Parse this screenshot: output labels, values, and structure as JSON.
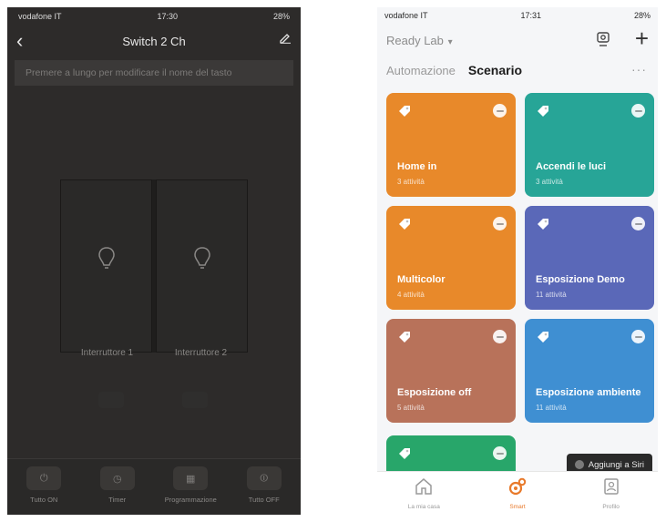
{
  "left_phone": {
    "status": {
      "carrier": "vodafone IT",
      "time": "17:30",
      "battery": "28%"
    },
    "nav": {
      "title": "Switch 2 Ch"
    },
    "hint": "Premere a lungo per modificare il nome del tasto",
    "switch_labels": [
      "Interruttore 1",
      "Interruttore 2"
    ],
    "bottom_bar": [
      {
        "label": "Tutto ON",
        "icon": "power-icon"
      },
      {
        "label": "Timer",
        "icon": "timer-icon"
      },
      {
        "label": "Programmazione",
        "icon": "schedule-icon"
      },
      {
        "label": "Tutto OFF",
        "icon": "power-off-icon"
      }
    ],
    "colors": {
      "background": "#2d2b2a",
      "panel": "#1f1e1d"
    }
  },
  "right_phone": {
    "status": {
      "carrier": "vodafone IT",
      "time": "17:31",
      "battery": "28%"
    },
    "home_name": "Ready Lab",
    "tabs": {
      "automation": "Automazione",
      "scenario": "Scenario"
    },
    "scenes": [
      {
        "name": "Home in",
        "sub": "3 attività",
        "color": "#e8892a"
      },
      {
        "name": "Accendi le luci",
        "sub": "3 attività",
        "color": "#27a597"
      },
      {
        "name": "Multicolor",
        "sub": "4 attività",
        "color": "#e8892a"
      },
      {
        "name": "Esposizione Demo",
        "sub": "11 attività",
        "color": "#5a68b8"
      },
      {
        "name": "Esposizione off",
        "sub": "5 attività",
        "color": "#b8725a"
      },
      {
        "name": "Esposizione ambiente",
        "sub": "11 attività",
        "color": "#3f8fd2"
      }
    ],
    "last_card_color": "#28a66a",
    "siri_button": "Aggiungi a Siri",
    "tabbar": [
      {
        "label": "La mia casa",
        "icon": "home-icon",
        "active": false
      },
      {
        "label": "Smart",
        "icon": "smart-icon",
        "active": true
      },
      {
        "label": "Profilo",
        "icon": "profile-icon",
        "active": false
      }
    ],
    "colors": {
      "accent": "#e8792a"
    }
  }
}
